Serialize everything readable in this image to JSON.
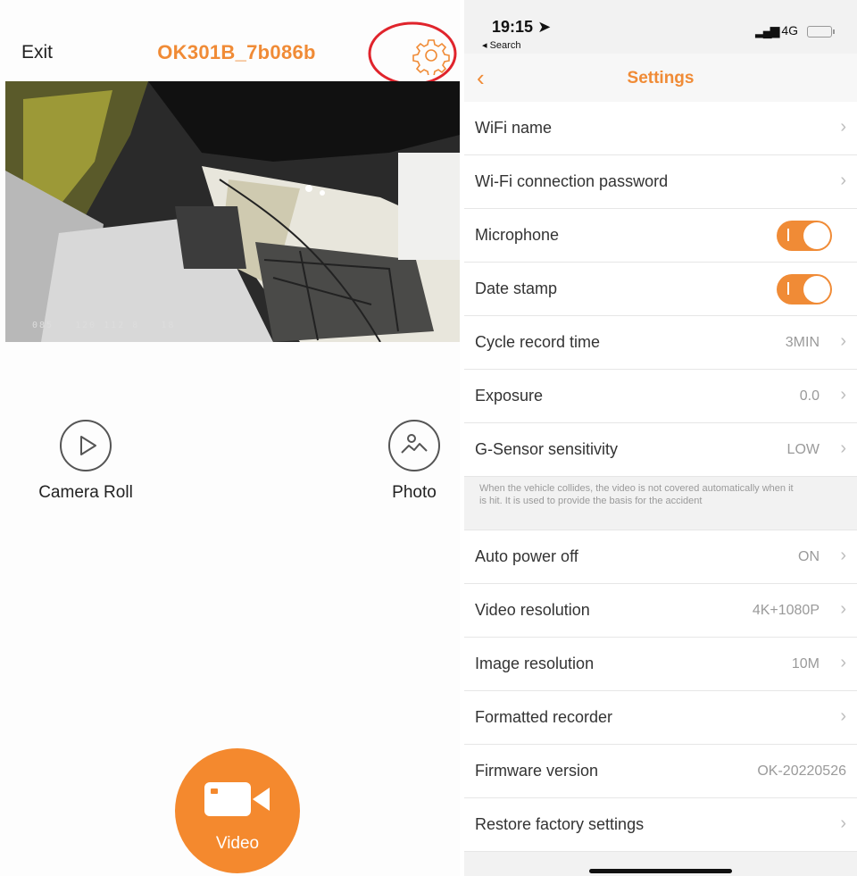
{
  "camera": {
    "exit_label": "Exit",
    "device_name": "OK301B_7b086b",
    "settings_icon": "gear-icon",
    "highlight_color": "#e0242c",
    "osd_text": "085   120 112 8   18",
    "camera_roll_label": "Camera Roll",
    "photo_label": "Photo",
    "video_label": "Video",
    "accent": "#f08b36"
  },
  "status_bar": {
    "time": "19:15",
    "back_app": "Search",
    "network": "4G"
  },
  "settings": {
    "title": "Settings",
    "rows": [
      {
        "label": "WiFi name",
        "value": "",
        "type": "link"
      },
      {
        "label": "Wi-Fi connection password",
        "value": "",
        "type": "link"
      },
      {
        "label": "Microphone",
        "value": "on",
        "type": "toggle"
      },
      {
        "label": "Date stamp",
        "value": "on",
        "type": "toggle"
      },
      {
        "label": "Cycle record time",
        "value": "3MIN",
        "type": "link"
      },
      {
        "label": "Exposure",
        "value": "0.0",
        "type": "link"
      },
      {
        "label": "G-Sensor sensitivity",
        "value": "LOW",
        "type": "link"
      },
      {
        "label": "Auto power off",
        "value": "ON",
        "type": "link"
      },
      {
        "label": "Video resolution",
        "value": "4K+1080P",
        "type": "link"
      },
      {
        "label": "Image resolution",
        "value": "10M",
        "type": "link"
      },
      {
        "label": "Formatted recorder",
        "value": "",
        "type": "link"
      },
      {
        "label": "Firmware version",
        "value": "OK-20220526",
        "type": "static"
      },
      {
        "label": "Restore factory settings",
        "value": "",
        "type": "link"
      }
    ],
    "gsensor_note": "When the vehicle collides, the video is not covered automatically when it is hit. It is used to provide the basis for the accident"
  }
}
